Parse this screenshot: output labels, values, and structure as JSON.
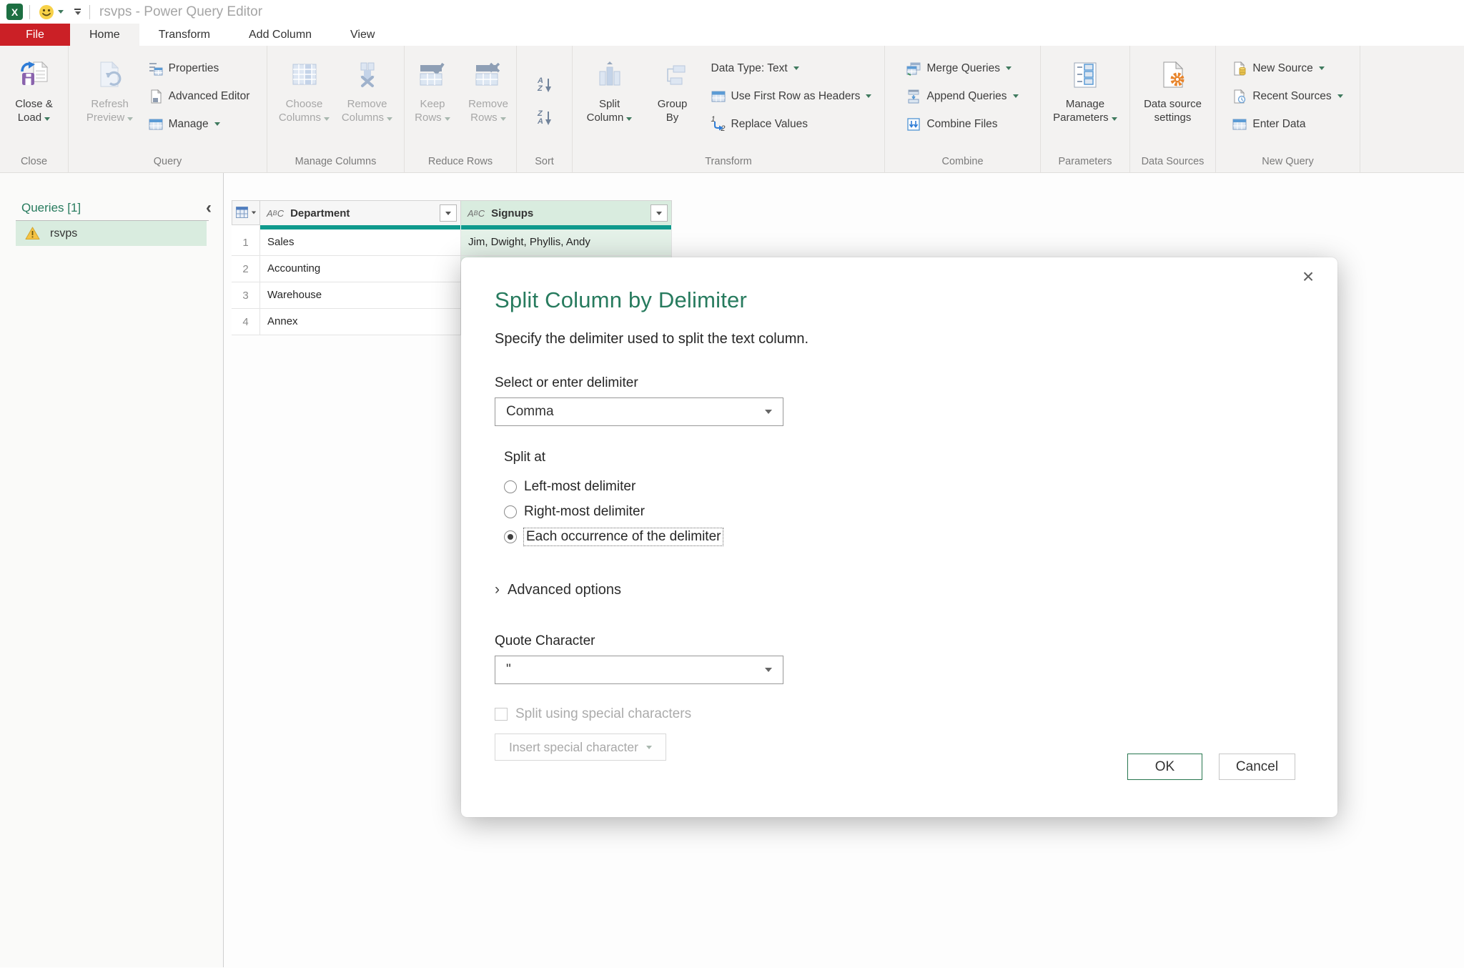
{
  "titlebar": {
    "title": "rsvps - Power Query Editor"
  },
  "tabs": {
    "file": "File",
    "home": "Home",
    "transform": "Transform",
    "add_column": "Add Column",
    "view": "View"
  },
  "ribbon": {
    "close": {
      "label": "Close",
      "close_load": {
        "line1": "Close &",
        "line2": "Load"
      }
    },
    "query": {
      "label": "Query",
      "refresh": {
        "line1": "Refresh",
        "line2": "Preview"
      },
      "properties": "Properties",
      "advanced_editor": "Advanced Editor",
      "manage": "Manage"
    },
    "manage_columns": {
      "label": "Manage Columns",
      "choose": {
        "line1": "Choose",
        "line2": "Columns"
      },
      "remove": {
        "line1": "Remove",
        "line2": "Columns"
      }
    },
    "reduce_rows": {
      "label": "Reduce Rows",
      "keep": {
        "line1": "Keep",
        "line2": "Rows"
      },
      "remove": {
        "line1": "Remove",
        "line2": "Rows"
      }
    },
    "sort": {
      "label": "Sort"
    },
    "transform": {
      "label": "Transform",
      "split_column": {
        "line1": "Split",
        "line2": "Column"
      },
      "group_by": {
        "line1": "Group",
        "line2": "By"
      },
      "data_type": "Data Type: Text",
      "first_row": "Use First Row as Headers",
      "replace_values": "Replace Values"
    },
    "combine": {
      "label": "Combine",
      "merge": "Merge Queries",
      "append": "Append Queries",
      "combine_files": "Combine Files"
    },
    "parameters": {
      "label": "Parameters",
      "manage_parameters": {
        "line1": "Manage",
        "line2": "Parameters"
      }
    },
    "data_sources": {
      "label": "Data Sources",
      "settings": {
        "line1": "Data source",
        "line2": "settings"
      }
    },
    "new_query": {
      "label": "New Query",
      "new_source": "New Source",
      "recent_sources": "Recent Sources",
      "enter_data": "Enter Data"
    }
  },
  "queries_pane": {
    "header": "Queries [1]",
    "items": [
      {
        "name": "rsvps",
        "warning": true
      }
    ]
  },
  "grid": {
    "columns": [
      {
        "type": "ABC",
        "name": "Department"
      },
      {
        "type": "ABC",
        "name": "Signups",
        "selected": true
      }
    ],
    "rows": [
      {
        "num": "1",
        "department": "Sales",
        "signups": "Jim, Dwight, Phyllis, Andy"
      },
      {
        "num": "2",
        "department": "Accounting",
        "signups": ""
      },
      {
        "num": "3",
        "department": "Warehouse",
        "signups": ""
      },
      {
        "num": "4",
        "department": "Annex",
        "signups": ""
      }
    ]
  },
  "dialog": {
    "title": "Split Column by Delimiter",
    "subtitle": "Specify the delimiter used to split the text column.",
    "delimiter_label": "Select or enter delimiter",
    "delimiter_value": "Comma",
    "split_at_label": "Split at",
    "options": [
      {
        "label": "Left-most delimiter",
        "selected": false
      },
      {
        "label": "Right-most delimiter",
        "selected": false
      },
      {
        "label": "Each occurrence of the delimiter",
        "selected": true
      }
    ],
    "advanced_options_label": "Advanced options",
    "quote_label": "Quote Character",
    "quote_value": "\"",
    "special_checkbox_label": "Split using special characters",
    "insert_special_label": "Insert special character",
    "ok_label": "OK",
    "cancel_label": "Cancel"
  },
  "colors": {
    "accent_green": "#277b5e",
    "file_tab_red": "#cb2026",
    "quality_bar_teal": "#0f9a8d",
    "selected_column_header_bg": "#d9ecdf",
    "selected_cell_bg": "#e4f1e8",
    "warning_yellow": "#f5c344",
    "excel_green": "#1d6f42"
  }
}
